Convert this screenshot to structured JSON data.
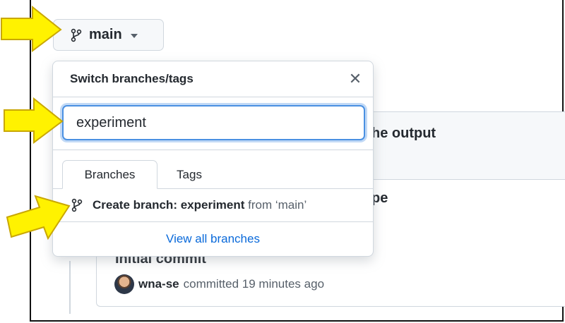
{
  "branch_button": {
    "label": "main",
    "icon": "git-branch-icon"
  },
  "dropdown": {
    "title": "Switch branches/tags",
    "close_icon": "close-icon",
    "search_value": "experiment",
    "tabs": [
      {
        "label": "Branches",
        "active": true
      },
      {
        "label": "Tags",
        "active": false
      }
    ],
    "create_row": {
      "prefix": "Create branch: experiment",
      "suffix": "from ‘main’"
    },
    "view_all": "View all branches"
  },
  "background": {
    "line1": "he output",
    "line2": "pe",
    "commit_title": "Initial commit",
    "commit_author": "wna-se",
    "commit_time": "committed 19 minutes ago"
  },
  "colors": {
    "arrow_fill": "#fff200",
    "arrow_stroke": "#c9a700",
    "link": "#0969da",
    "focus": "#4a90e2"
  }
}
